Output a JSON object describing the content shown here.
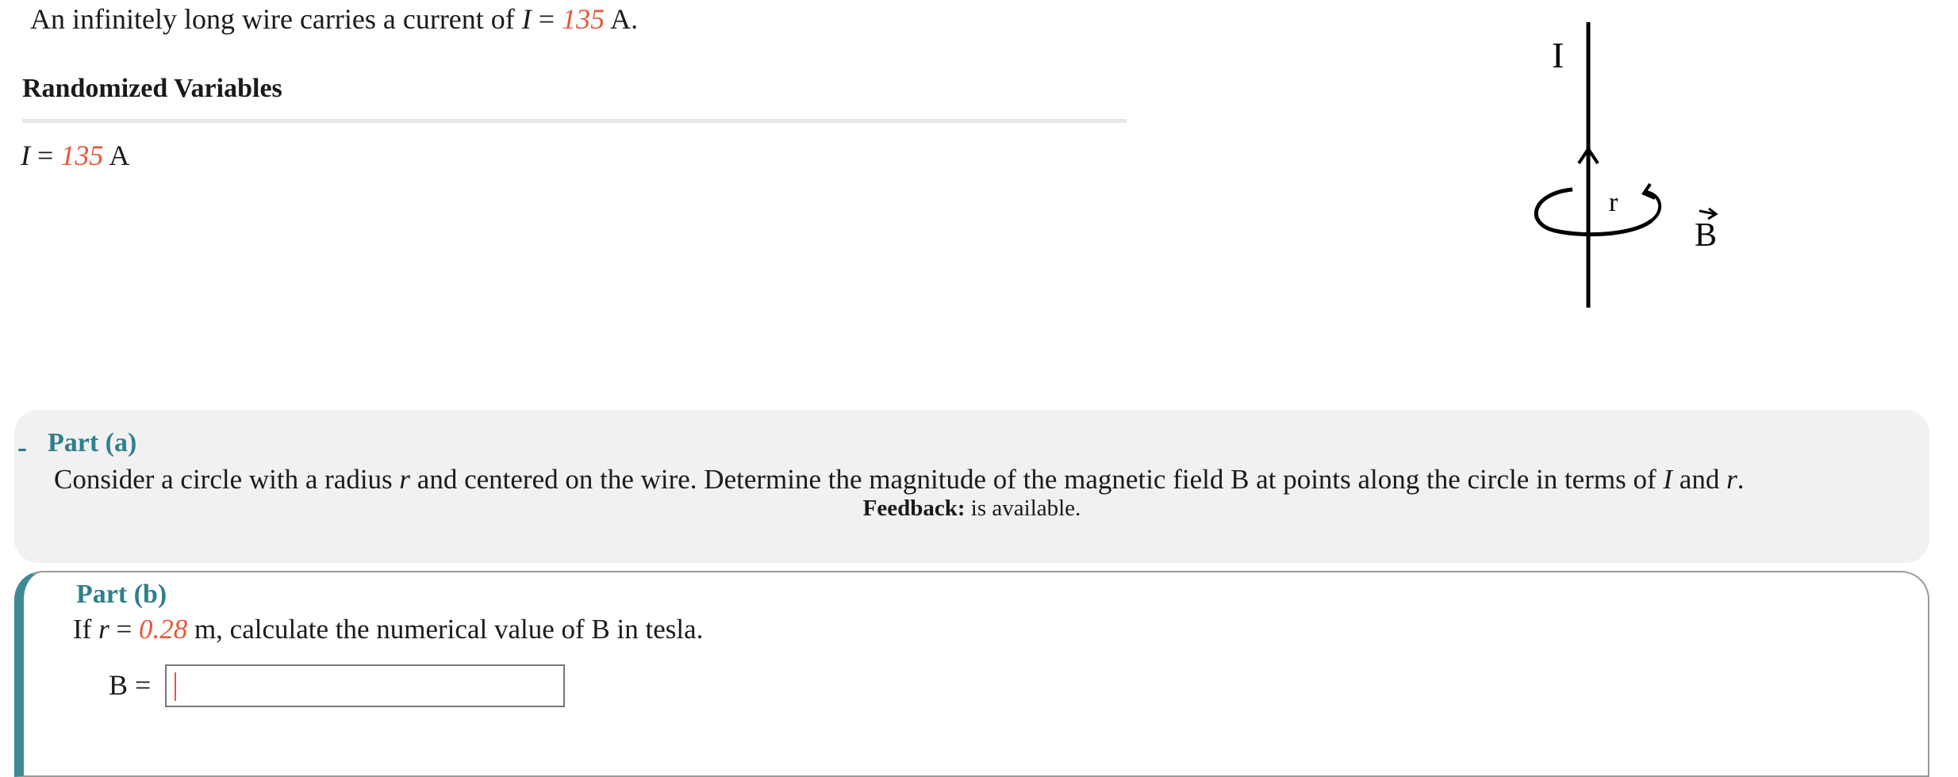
{
  "problem": {
    "prefix": "An infinitely long wire carries a current of ",
    "var_name": "I",
    "equals": " = ",
    "value": "135",
    "unit": " A."
  },
  "randomized": {
    "heading": "Randomized Variables",
    "var_name": "I",
    "equals": " = ",
    "value": "135",
    "unit": " A"
  },
  "figure": {
    "current_label": "I",
    "radius_label": "r",
    "field_label": "B"
  },
  "part_a": {
    "collapse_symbol": "-",
    "title": "Part (a)",
    "question_1": "Consider a circle with a radius ",
    "question_r": "r",
    "question_2": " and centered on the wire. Determine the magnitude of the magnetic field B at points along the circle in terms of ",
    "question_I": "I",
    "question_3": " and ",
    "question_r2": "r",
    "question_4": ".",
    "feedback_bold": "Feedback:",
    "feedback_rest": " is available."
  },
  "part_b": {
    "title": "Part (b)",
    "question_1": "If ",
    "question_r": "r",
    "question_eq": " = ",
    "r_value": "0.28",
    "question_2": " m, calculate the numerical value of B in tesla.",
    "answer_label": "B =",
    "answer_value": ""
  },
  "colors": {
    "variable_accent": "#e8573a",
    "part_title": "#2f7f8c",
    "part_border": "#3d8a96",
    "part_a_background": "#f1f1f1"
  }
}
